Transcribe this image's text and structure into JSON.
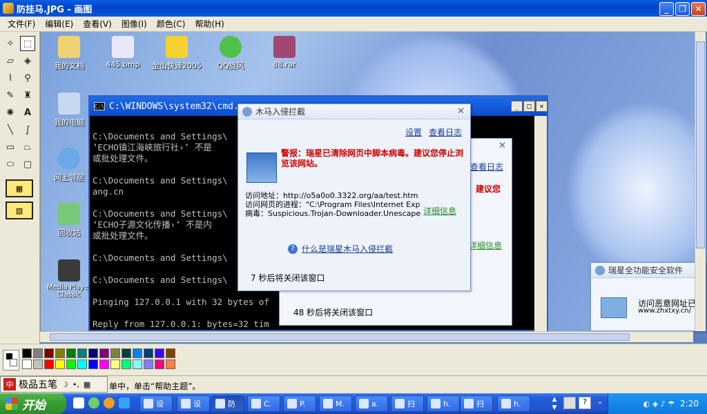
{
  "paint": {
    "title": "防挂马.JPG - 画图",
    "menu": [
      "文件(F)",
      "编辑(E)",
      "查看(V)",
      "图像(I)",
      "颜色(C)",
      "帮助(H)"
    ],
    "status_text": "单中，单击“帮助主题”。",
    "palette_row1": [
      "#000000",
      "#808080",
      "#800000",
      "#808000",
      "#008000",
      "#008080",
      "#000080",
      "#800080",
      "#808040",
      "#004040",
      "#0080ff",
      "#004080",
      "#4000ff",
      "#804000"
    ],
    "palette_row2": [
      "#ffffff",
      "#c0c0c0",
      "#ff0000",
      "#ffff00",
      "#00ff00",
      "#00ffff",
      "#0000ff",
      "#ff00ff",
      "#ffff80",
      "#00ff80",
      "#80ffff",
      "#8080ff",
      "#ff0080",
      "#ff8040"
    ]
  },
  "desktop": {
    "icons": [
      {
        "label": "我的文档",
        "color": "#f0d070"
      },
      {
        "label": "445.bmp",
        "color": "#e8e8f8"
      },
      {
        "label": "金山快译2005",
        "color": "#f6d12e"
      },
      {
        "label": "QQ旋风",
        "color": "#4fc04a"
      },
      {
        "label": "88.rar",
        "color": "#a04870"
      },
      {
        "label": "我的电脑",
        "color": "#c8d8f0"
      },
      {
        "label": "网上邻居",
        "color": "#6aa8e8"
      },
      {
        "label": "回收站",
        "color": "#78c878"
      },
      {
        "label": "Media Player Classic",
        "color": "#3a3a3a"
      }
    ]
  },
  "cmd": {
    "title": "C:\\WINDOWS\\system32\\cmd.",
    "lines": [
      "",
      "C:\\Documents and Settings\\",
      "’ECHO镇江海峡旅行社›’ 不是",
      "或批处理文件。",
      "",
      "C:\\Documents and Settings\\                                       ihish",
      "ang.cn",
      "",
      "C:\\Documents and Settings\\",
      "’ECHO子源文化传播›’ 不是内",
      "或批处理文件。",
      "",
      "C:\\Documents and Settings\\                                       cn",
      "",
      "C:\\Documents and Settings\\",
      "",
      "Pinging 127.0.0.1 with 32 bytes of",
      "",
      "Reply from 127.0.0.1: bytes=32 tim"
    ]
  },
  "dialog_main": {
    "title": "木马入侵拦截",
    "settings": "设置",
    "view_log": "查看日志",
    "alert": "警报：瑞星已清除网页中脚本病毒。建议您停止浏览该网站。",
    "url_label": "访问地址：http://o5a0o0.3322.org/aa/test.htm",
    "process_label": "访问网页的进程：\"C:\\Program Files\\Internet Explorer",
    "virus_label": "病毒：Suspicious.Trojan-Downloader.Unescape.She",
    "details": "详细信息",
    "what_is": "什么是瑞星木马入侵拦截",
    "countdown": "7 秒后将关闭该窗口"
  },
  "dialog_back": {
    "view_log": "查看日志",
    "suggest": "建议您",
    "details": "详细信息",
    "countdown": "48 秒后将关闭该窗口"
  },
  "dialog_right": {
    "title": "瑞星全功能安全软件",
    "line1": "访问恶意网址已",
    "line2": "www.zhxtxy.cn/"
  },
  "taskbar": {
    "start": "开始",
    "clock": "2:20",
    "ime": "极品五笔",
    "tasks": [
      "设",
      "设",
      "防",
      "C.",
      "P.",
      "M.",
      "a.",
      "扫",
      "h.",
      "扫",
      "h."
    ]
  }
}
